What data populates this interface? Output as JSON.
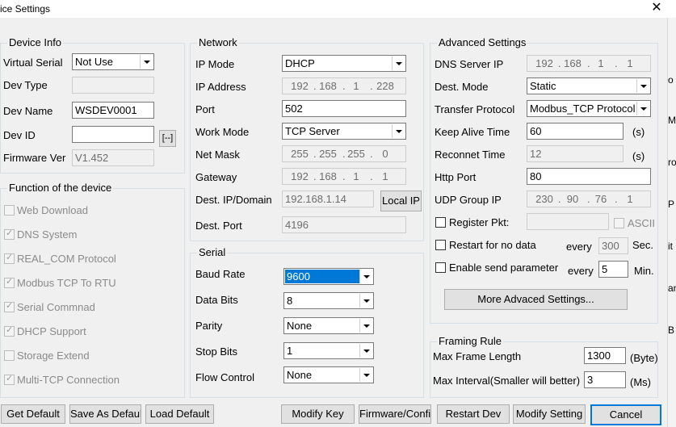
{
  "window": {
    "title": "ice Settings",
    "close_glyph": "✕"
  },
  "right_strip": [
    "o",
    "M",
    "ro",
    "P",
    "it",
    "an",
    "B"
  ],
  "device_info": {
    "legend": "Device Info",
    "virtual_serial_label": "Virtual Serial",
    "virtual_serial_value": "Not Use",
    "dev_type_label": "Dev Type",
    "dev_type_value": "",
    "dev_name_label": "Dev Name",
    "dev_name_value": "WSDEV0001",
    "dev_id_label": "Dev ID",
    "dev_id_value": "",
    "dev_id_button": "[--]",
    "firmware_label": "Firmware Ver",
    "firmware_value": "V1.452"
  },
  "functions": {
    "legend": "Function of the device",
    "items": [
      {
        "label": "Web Download",
        "checked": false
      },
      {
        "label": "DNS System",
        "checked": true
      },
      {
        "label": "REAL_COM Protocol",
        "checked": true
      },
      {
        "label": "Modbus TCP To RTU",
        "checked": true
      },
      {
        "label": "Serial Commnad",
        "checked": true
      },
      {
        "label": "DHCP Support",
        "checked": true
      },
      {
        "label": "Storage Extend",
        "checked": false
      },
      {
        "label": "Multi-TCP Connection",
        "checked": true
      }
    ]
  },
  "network": {
    "legend": "Network",
    "ip_mode_label": "IP Mode",
    "ip_mode_value": "DHCP",
    "ip_address_label": "IP Address",
    "ip_address": [
      "192",
      "168",
      "1",
      "228"
    ],
    "port_label": "Port",
    "port_value": "502",
    "work_mode_label": "Work Mode",
    "work_mode_value": "TCP Server",
    "net_mask_label": "Net Mask",
    "net_mask": [
      "255",
      "255",
      "255",
      "0"
    ],
    "gateway_label": "Gateway",
    "gateway": [
      "192",
      "168",
      "1",
      "1"
    ],
    "dest_ip_label": "Dest. IP/Domain",
    "dest_ip_value": "192.168.1.14",
    "local_ip_button": "Local IP",
    "dest_port_label": "Dest. Port",
    "dest_port_value": "4196"
  },
  "serial": {
    "legend": "Serial",
    "baud_rate_label": "Baud Rate",
    "baud_rate_value": "9600",
    "data_bits_label": "Data Bits",
    "data_bits_value": "8",
    "parity_label": "Parity",
    "parity_value": "None",
    "stop_bits_label": "Stop Bits",
    "stop_bits_value": "1",
    "flow_control_label": "Flow Control",
    "flow_control_value": "None"
  },
  "advanced": {
    "legend": "Advanced Settings",
    "dns_label": "DNS Server IP",
    "dns_ip": [
      "192",
      "168",
      "1",
      "1"
    ],
    "dest_mode_label": "Dest. Mode",
    "dest_mode_value": "Static",
    "transfer_label": "Transfer Protocol",
    "transfer_value": "Modbus_TCP Protocol",
    "keepalive_label": "Keep Alive Time",
    "keepalive_value": "60",
    "keepalive_unit": "(s)",
    "reconnect_label": "Reconnet Time",
    "reconnect_value": "12",
    "reconnect_unit": "(s)",
    "http_label": "Http Port",
    "http_value": "80",
    "udp_label": "UDP Group IP",
    "udp_ip": [
      "230",
      "90",
      "76",
      "1"
    ],
    "register_label": "Register Pkt:",
    "register_value": "",
    "ascii_label": "ASCII",
    "restart_label": "Restart for no data",
    "restart_every": "every",
    "restart_value": "300",
    "restart_unit": "Sec.",
    "send_param_label": "Enable send parameter",
    "send_every": "every",
    "send_value": "5",
    "send_unit": "Min.",
    "more_button": "More Advaced Settings..."
  },
  "framing": {
    "legend": "Framing Rule",
    "max_len_label": "Max Frame Length",
    "max_len_value": "1300",
    "max_len_unit": "(Byte)",
    "max_interval_label": "Max Interval(Smaller will better)",
    "max_interval_value": "3",
    "max_interval_unit": "(Ms)"
  },
  "buttons": {
    "get_default": "Get Default",
    "save_as_default": "Save As Default",
    "load_default": "Load Default",
    "modify_key": "Modify Key",
    "firmware_config": "Firmware/Config",
    "restart_dev": "Restart Dev",
    "modify_setting": "Modify Setting",
    "cancel": "Cancel"
  }
}
